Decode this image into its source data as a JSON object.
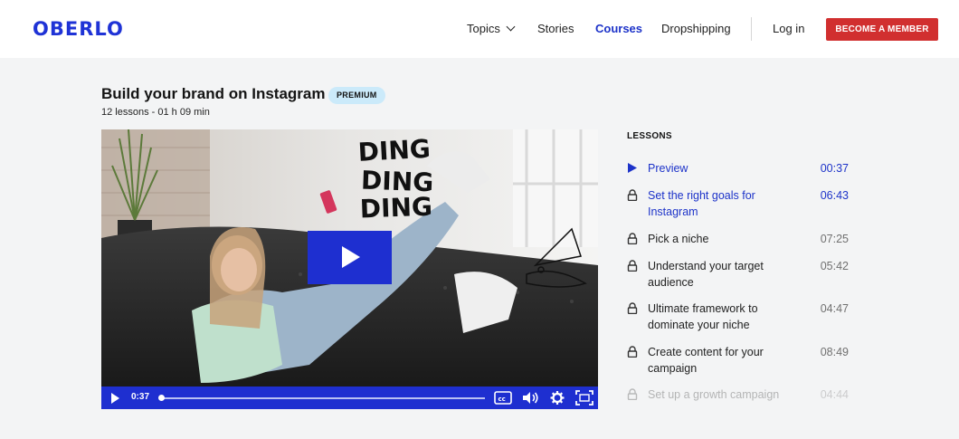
{
  "header": {
    "logo": "OBERLO",
    "nav": {
      "topics": "Topics",
      "stories": "Stories",
      "courses": "Courses",
      "dropshipping": "Dropshipping",
      "login": "Log in"
    },
    "member_button": "BECOME A MEMBER"
  },
  "course": {
    "title": "Build your brand on Instagram",
    "badge": "PREMIUM",
    "meta": "12 lessons - 01 h 09 min"
  },
  "video": {
    "overlay_text": [
      "DING",
      "DING",
      "DING"
    ],
    "current_time": "0:37",
    "progress": 0.0,
    "accent": "#1e2fd0"
  },
  "lessons": {
    "heading": "LESSONS",
    "items": [
      {
        "title": "Preview",
        "duration": "00:37",
        "icon": "play-icon",
        "state": "active"
      },
      {
        "title": "Set the right goals for Instagram",
        "duration": "06:43",
        "icon": "lock-icon",
        "state": "highlight"
      },
      {
        "title": "Pick a niche",
        "duration": "07:25",
        "icon": "lock-icon",
        "state": "normal"
      },
      {
        "title": "Understand your target audience",
        "duration": "05:42",
        "icon": "lock-icon",
        "state": "normal"
      },
      {
        "title": "Ultimate framework to dominate your niche",
        "duration": "04:47",
        "icon": "lock-icon",
        "state": "normal"
      },
      {
        "title": "Create content for your campaign",
        "duration": "08:49",
        "icon": "lock-icon",
        "state": "normal"
      },
      {
        "title": "Set up a growth campaign",
        "duration": "04:44",
        "icon": "lock-icon",
        "state": "faded"
      }
    ]
  },
  "colors": {
    "brand_blue": "#1f33d6",
    "cta_red": "#d12f2f",
    "badge_bg": "#cbeafa"
  }
}
